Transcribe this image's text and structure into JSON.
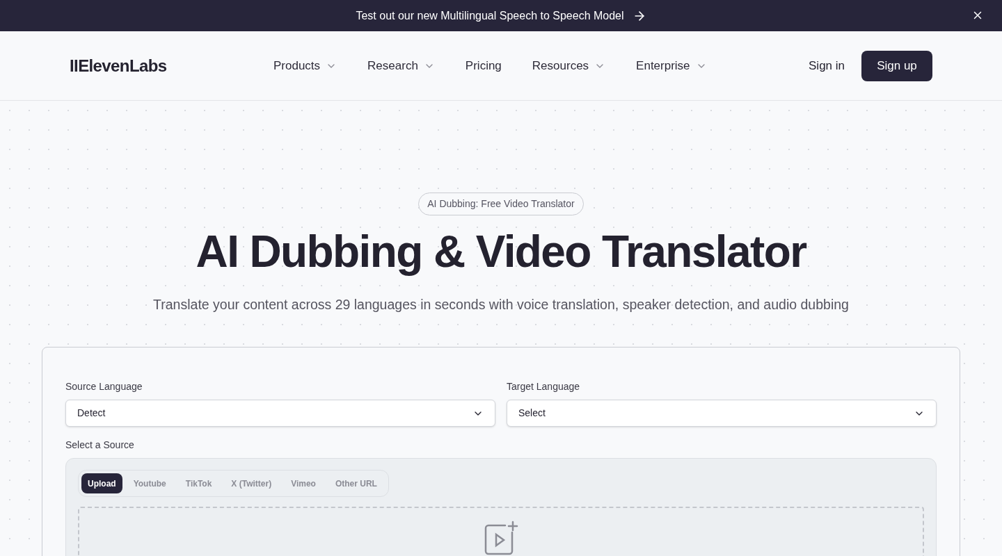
{
  "banner": {
    "text": "Test out our new Multilingual Speech to Speech Model"
  },
  "nav": {
    "logo": "IIElevenLabs",
    "items": [
      {
        "label": "Products",
        "has_menu": true
      },
      {
        "label": "Research",
        "has_menu": true
      },
      {
        "label": "Pricing",
        "has_menu": false
      },
      {
        "label": "Resources",
        "has_menu": true
      },
      {
        "label": "Enterprise",
        "has_menu": true
      }
    ],
    "sign_in": "Sign in",
    "sign_up": "Sign up"
  },
  "hero": {
    "badge": "AI Dubbing: Free Video Translator",
    "title": "AI Dubbing & Video Translator",
    "subtitle": "Translate your content across 29 languages in seconds with voice translation, speaker detection, and audio dubbing"
  },
  "form": {
    "fields": [
      {
        "label": "Source Language",
        "value": "Detect"
      },
      {
        "label": "Target Language",
        "value": "Select"
      }
    ],
    "source_label": "Select a Source",
    "tabs": [
      {
        "label": "Upload",
        "selected": true
      },
      {
        "label": "Youtube",
        "selected": false
      },
      {
        "label": "TikTok",
        "selected": false
      },
      {
        "label": "X (Twitter)",
        "selected": false
      },
      {
        "label": "Vimeo",
        "selected": false
      },
      {
        "label": "Other URL",
        "selected": false
      }
    ]
  }
}
